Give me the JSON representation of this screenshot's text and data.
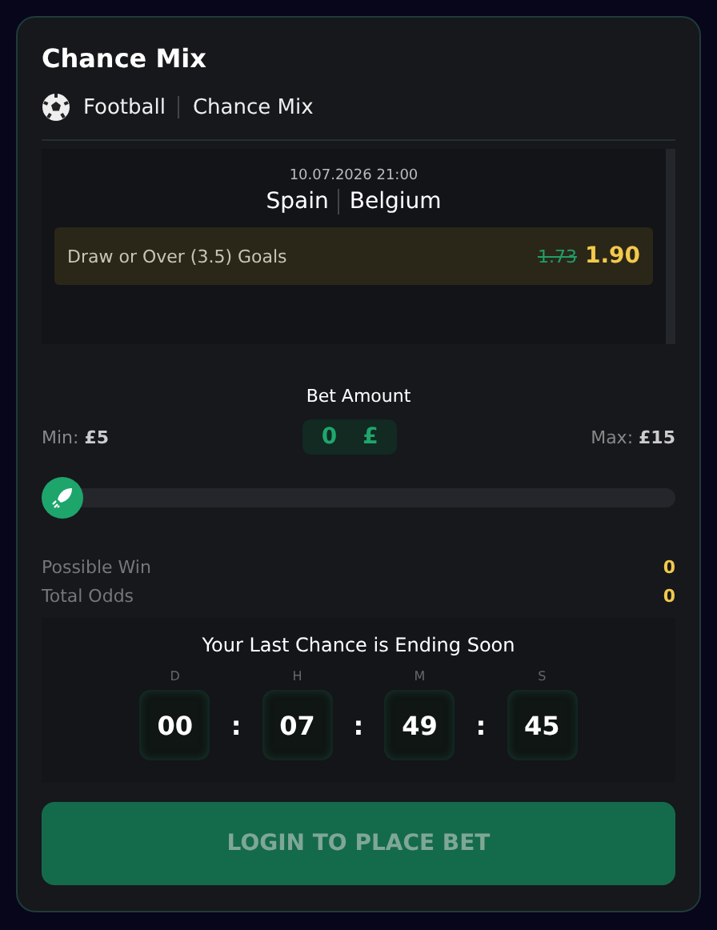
{
  "title": "Chance Mix",
  "breadcrumb": [
    "Football",
    "Chance Mix"
  ],
  "event": {
    "datetime": "10.07.2026 21:00",
    "teams": [
      "Spain",
      "Belgium"
    ],
    "selection": {
      "market": "Draw or Over (3.5) Goals",
      "old_odds": "1.73",
      "odds": "1.90"
    }
  },
  "bet": {
    "label": "Bet Amount",
    "min_label": "Min:",
    "min_value": "£5",
    "amount": "0",
    "currency": "£",
    "max_label": "Max:",
    "max_value": "£15",
    "level": 0
  },
  "summary": [
    {
      "label": "Possible Win",
      "value": "0"
    },
    {
      "label": "Total Odds",
      "value": "0"
    }
  ],
  "countdown": {
    "title": "Your Last Chance is Ending Soon",
    "units": [
      {
        "unit": "D",
        "value": "00"
      },
      {
        "unit": "H",
        "value": "07"
      },
      {
        "unit": "M",
        "value": "49"
      },
      {
        "unit": "S",
        "value": "45"
      }
    ],
    "separator": ":"
  },
  "button": {
    "label": "LOGIN TO PLACE BET",
    "disabled": true
  }
}
